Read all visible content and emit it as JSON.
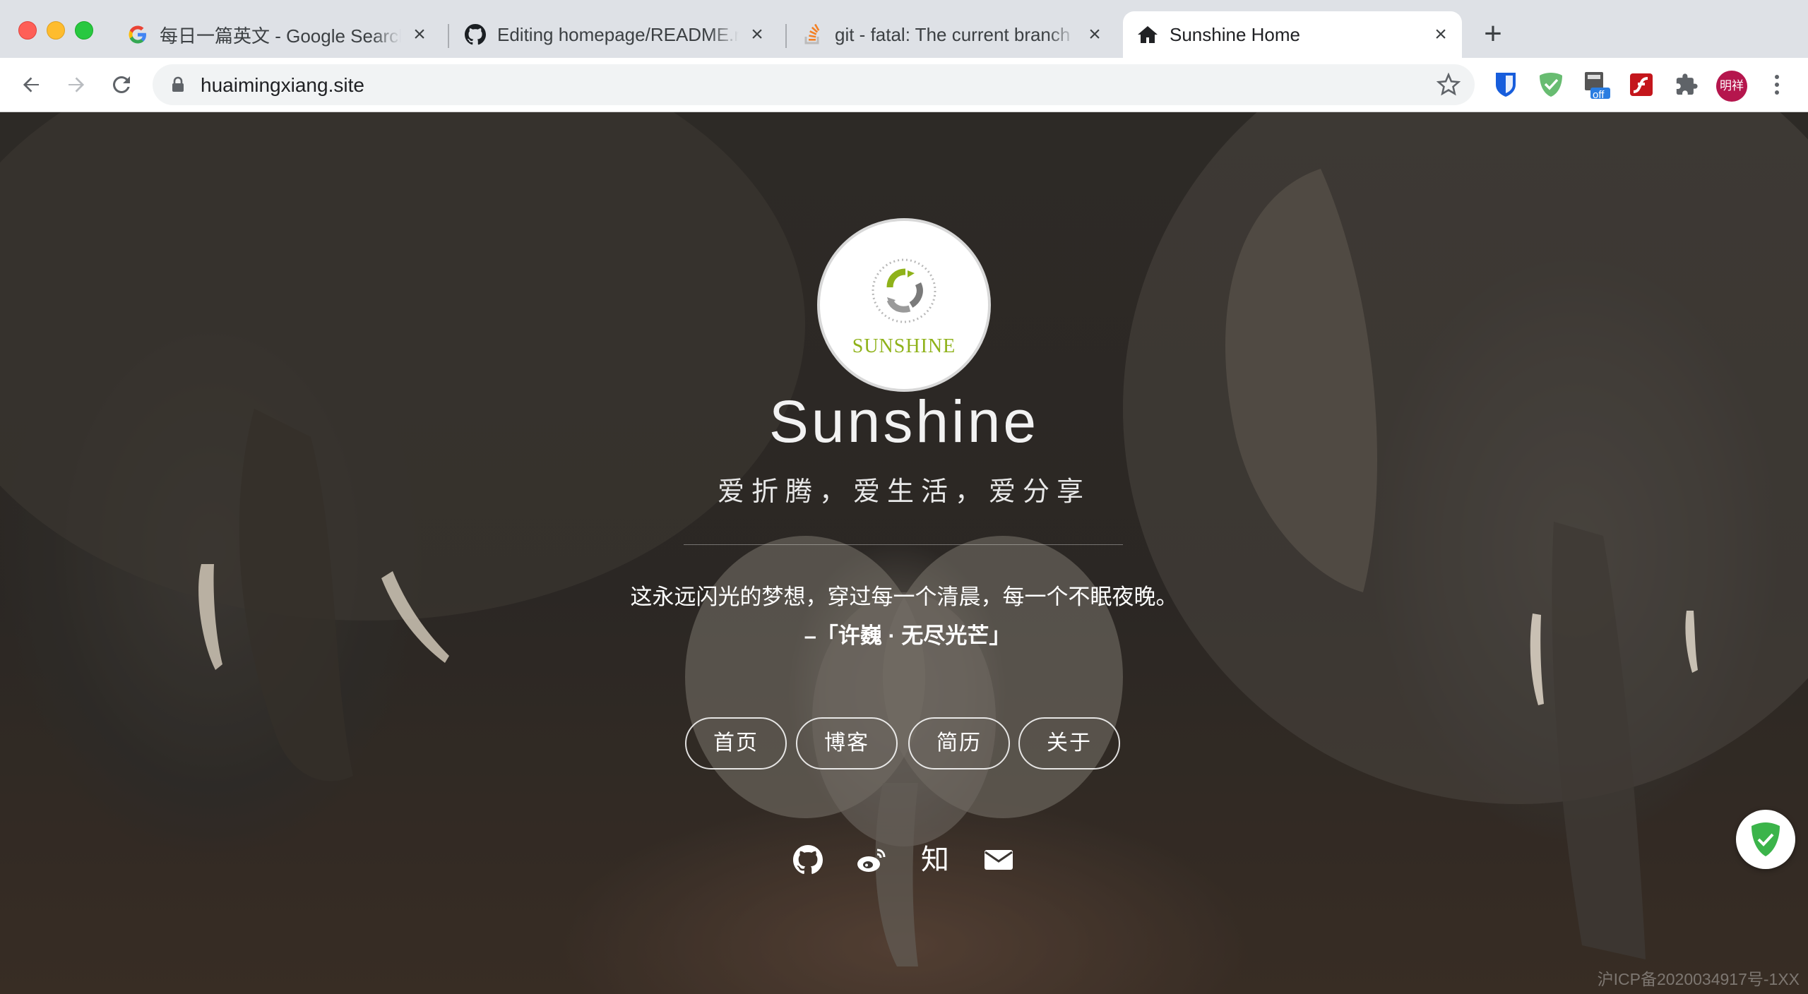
{
  "browser": {
    "tabs": [
      {
        "title": "每日一篇英文 - Google Search",
        "icon": "google-icon",
        "active": false
      },
      {
        "title": "Editing homepage/README.md",
        "icon": "github-icon",
        "active": false
      },
      {
        "title": "git - fatal: The current branch master",
        "icon": "stackoverflow-icon",
        "active": false
      },
      {
        "title": "Sunshine Home",
        "icon": "home-icon",
        "active": true
      }
    ],
    "close_glyph": "×",
    "new_tab_glyph": "+",
    "url": "huaimingxiang.site",
    "extensions": [
      "bitwarden-icon",
      "adguard-icon",
      "off-extension-icon",
      "flash-icon",
      "puzzle-icon"
    ],
    "off_badge": "off",
    "profile_initials": "明祥"
  },
  "page": {
    "logo_text": "SUNSHINE",
    "title": "Sunshine",
    "description": "爱折腾，爱生活，爱分享",
    "quote": "这永远闪光的梦想，穿过每一个清晨，每一个不眠夜晚。",
    "quote_source": "–「许巍 · 无尽光芒」",
    "nav": [
      {
        "label": "首页"
      },
      {
        "label": "博客"
      },
      {
        "label": "简历"
      },
      {
        "label": "关于"
      }
    ],
    "social": {
      "github": "github-icon",
      "weibo": "weibo-icon",
      "zhihu_label": "知",
      "email": "mail-icon"
    },
    "icp": "沪ICP备2020034917号-1XX"
  },
  "colors": {
    "accent_green": "#8fb21a",
    "profile": "#b5164d"
  }
}
